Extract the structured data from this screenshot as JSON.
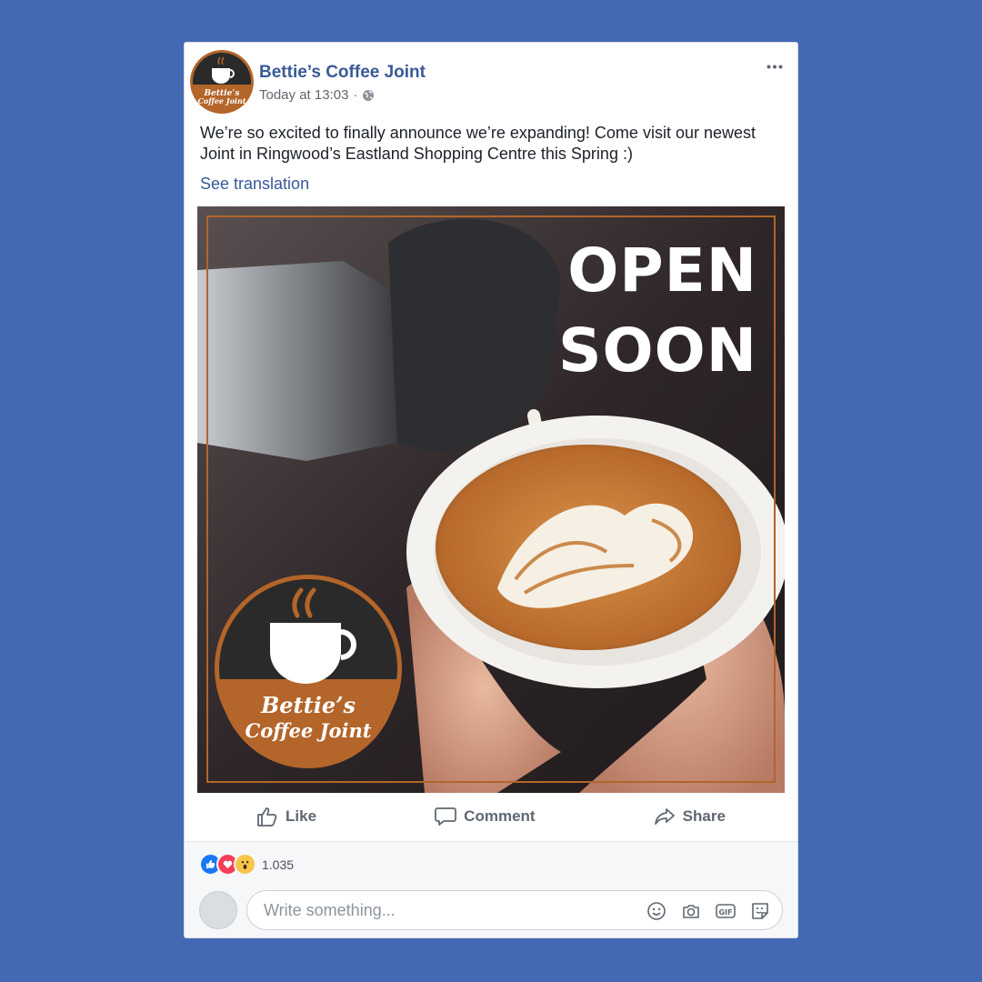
{
  "post": {
    "page_name": "Bettie’s Coffee Joint",
    "timestamp": "Today at 13:03",
    "privacy_separator": "·",
    "privacy_icon": "globe-icon",
    "text": "We’re so excited to finally announce we’re expanding! Come visit our newest Joint in Ringwood’s Eastland Shopping Centre this Spring :)",
    "see_translation": "See translation"
  },
  "image": {
    "headline_line1": "OPEN",
    "headline_line2": "SOON",
    "logo_line1": "Bettie’s",
    "logo_line2": "Coffee Joint"
  },
  "actions": {
    "like": "Like",
    "comment": "Comment",
    "share": "Share"
  },
  "reactions": {
    "icons": [
      "like-reaction-icon",
      "love-reaction-icon",
      "wow-reaction-icon"
    ],
    "count": "1.035"
  },
  "comment": {
    "placeholder": "Write something...",
    "tools": [
      "emoji-icon",
      "camera-icon",
      "gif-icon",
      "sticker-icon"
    ]
  },
  "colors": {
    "background": "#4469b3",
    "link": "#3b5998",
    "brand_orange": "#b3652a",
    "brand_dark": "#2b2a2a",
    "like_blue": "#1877f2",
    "love_red": "#f33e58",
    "wow_yellow": "#f7c648"
  }
}
